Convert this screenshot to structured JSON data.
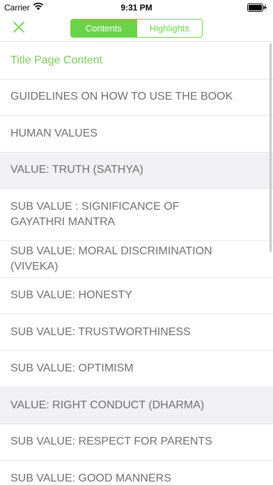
{
  "status_bar": {
    "carrier": "Carrier",
    "time": "9:31 PM",
    "icons": [
      "wifi-icon",
      "battery-icon",
      "charging-icon"
    ]
  },
  "nav": {
    "close_icon": "close-x-icon",
    "segments": [
      {
        "label": "Contents",
        "selected": true
      },
      {
        "label": "Highlights",
        "selected": false
      }
    ]
  },
  "colors": {
    "accent": "#6bd34a",
    "current_item": "#7cc95a",
    "row_text": "#6f6f6f",
    "shaded_row": "#f1f1f3",
    "divider": "#e6e6e6"
  },
  "toc": {
    "items": [
      {
        "label": "Title Page Content",
        "current": true,
        "shaded": false
      },
      {
        "label": "GUIDELINES ON HOW TO USE THE BOOK",
        "current": false,
        "shaded": false
      },
      {
        "label": "HUMAN VALUES",
        "current": false,
        "shaded": false
      },
      {
        "label": "VALUE: TRUTH (SATHYA)",
        "current": false,
        "shaded": true
      },
      {
        "label": "SUB VALUE : SIGNIFICANCE OF\nGAYATHRI MANTRA",
        "current": false,
        "shaded": false
      },
      {
        "label": "SUB VALUE: MORAL DISCRIMINATION (VIVEKA)",
        "current": false,
        "shaded": false
      },
      {
        "label": "SUB VALUE: HONESTY",
        "current": false,
        "shaded": false
      },
      {
        "label": "SUB VALUE: TRUSTWORTHINESS",
        "current": false,
        "shaded": false
      },
      {
        "label": "SUB VALUE: OPTIMISM",
        "current": false,
        "shaded": false
      },
      {
        "label": "VALUE: RIGHT CONDUCT (DHARMA)",
        "current": false,
        "shaded": true
      },
      {
        "label": "SUB VALUE: RESPECT FOR PARENTS",
        "current": false,
        "shaded": false
      },
      {
        "label": "SUB VALUE: GOOD MANNERS",
        "current": false,
        "shaded": false
      }
    ]
  }
}
